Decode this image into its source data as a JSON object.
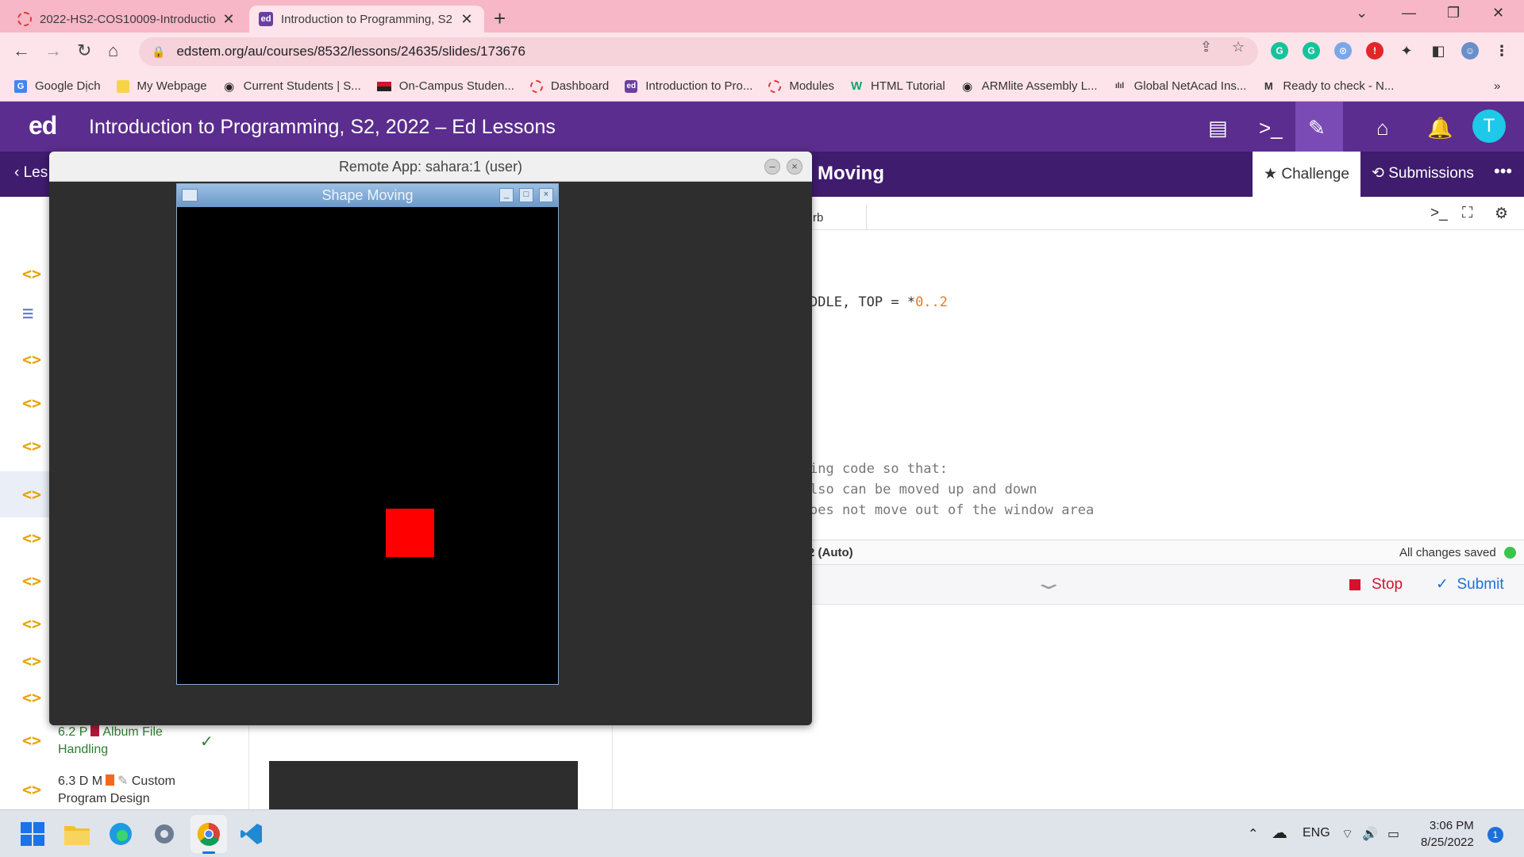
{
  "browser": {
    "tabs": [
      {
        "title": "2022-HS2-COS10009-Introductio",
        "active": false
      },
      {
        "title": "Introduction to Programming, S2",
        "active": true
      }
    ],
    "url": "edstem.org/au/courses/8532/lessons/24635/slides/173676",
    "bookmarks": [
      {
        "label": "Google Dịch",
        "icon": "google-translate-icon"
      },
      {
        "label": "My Webpage",
        "icon": "folder-icon"
      },
      {
        "label": "Current Students | S...",
        "icon": "globe-icon"
      },
      {
        "label": "On-Campus Studen...",
        "icon": "flag-icon"
      },
      {
        "label": "Dashboard",
        "icon": "canvas-icon"
      },
      {
        "label": "Introduction to Pro...",
        "icon": "ed-icon"
      },
      {
        "label": "Modules",
        "icon": "canvas-icon"
      },
      {
        "label": "HTML Tutorial",
        "icon": "w3schools-icon"
      },
      {
        "label": "ARMlite Assembly L...",
        "icon": "globe-icon"
      },
      {
        "label": "Global NetAcad Ins...",
        "icon": "cisco-icon"
      },
      {
        "label": "Ready to check - N...",
        "icon": "bookmark-icon"
      }
    ]
  },
  "ed": {
    "logo": "ed",
    "title": "Introduction to Programming, S2, 2022 – Ed Lessons",
    "avatar_letter": "T",
    "back_label": "Les",
    "lesson_title": "e Moving",
    "challenge_label": "Challenge",
    "submissions_label": "Submissions"
  },
  "sidebar": {
    "item_62_prefix": "6.2 P",
    "item_62_name": "Album File",
    "item_62_name2": "Handling",
    "item_63_prefix": "6.3 D M",
    "item_63_name": "Custom",
    "item_63_name2": "Program Design"
  },
  "editor": {
    "tab_label": "rb",
    "code_line1_text": "DDLE, TOP = *",
    "code_line1_num": "0..2",
    "comment_lines": [
      "ing code so that:",
      "lso can be moved up and down",
      "oes not move out of the window area"
    ],
    "status_left": "2 (Auto)",
    "status_right": "All changes saved",
    "stop_label": "Stop",
    "submit_label": "Submit"
  },
  "remote_app": {
    "title": "Remote App: sahara:1 (user)",
    "shape_window_title": "Shape Moving",
    "shape_color": "#ff0000"
  },
  "taskbar": {
    "lang": "ENG",
    "time": "3:06 PM",
    "date": "8/25/2022",
    "notification_count": "1"
  }
}
